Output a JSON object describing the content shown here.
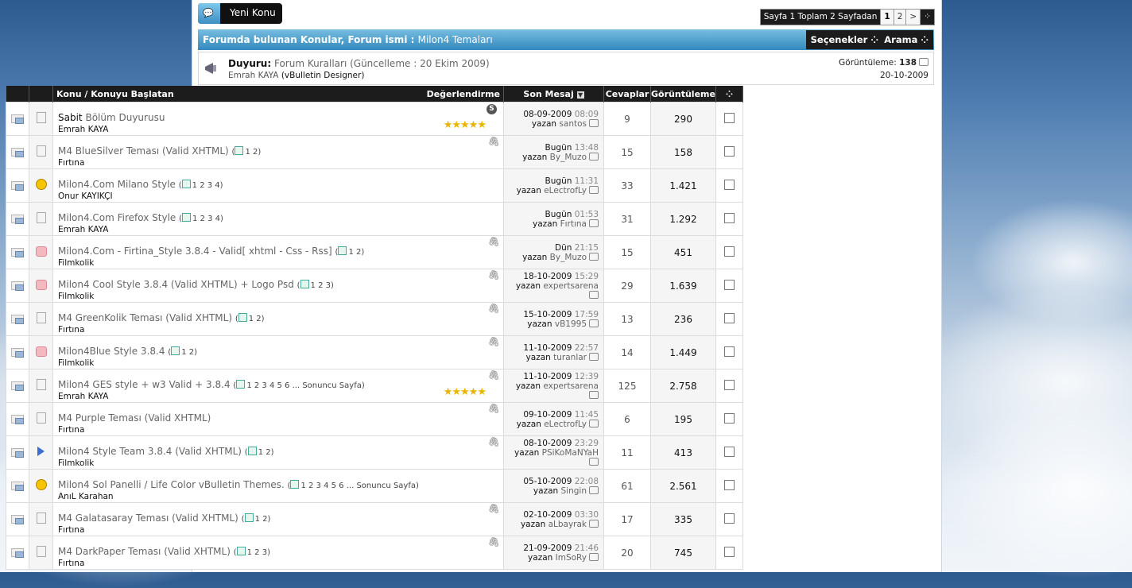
{
  "toolbar": {
    "new_topic": "Yeni Konu"
  },
  "pager": {
    "label": "Sayfa 1 Toplam 2 Sayfadan",
    "current": "1",
    "next_page": "2",
    "next": ">"
  },
  "forum": {
    "title_prefix": "Forumda bulunan Konular, Forum ismi",
    "title_name": "Milon4 Temaları",
    "options": "Seçenekler",
    "search": "Arama"
  },
  "announcement": {
    "label": "Duyuru:",
    "title": "Forum Kuralları (Güncelleme : 20 Ekim 2009)",
    "author": "Emrah KAYA",
    "author_title": "(vBulletin Designer)",
    "views_label": "Görüntüleme:",
    "views": "138",
    "date": "20-10-2009"
  },
  "columns": {
    "topic": "Konu / Konuyu Başlatan",
    "rating": "Değerlendirme",
    "last_post": "Son Mesaj",
    "replies": "Cevaplar",
    "views": "Görüntüleme"
  },
  "last_separator": "Sonuncu Sayfa",
  "threads": [
    {
      "prefix": "Sabit",
      "title": "Bölüm Duyurusu",
      "author": "Emrah KAYA",
      "pages": "",
      "date": "08-09-2009",
      "time": "08:09",
      "by": "yazan",
      "user": "santos",
      "replies": "9",
      "views": "290",
      "icon": "doc",
      "stars": "★★★★★",
      "sticky": "S",
      "attach": false
    },
    {
      "prefix": "",
      "title": "M4 BlueSilver Teması (Valid XHTML)",
      "author": "Fırtına",
      "pages": "1 2",
      "date": "Bugün",
      "time": "13:48",
      "by": "yazan",
      "user": "By_Muzo",
      "replies": "15",
      "views": "158",
      "icon": "doc",
      "stars": "",
      "sticky": "",
      "attach": true
    },
    {
      "prefix": "",
      "title": "Milon4.Com Milano Style",
      "author": "Onur KAYIKÇI",
      "pages": "1 2 3 4",
      "date": "Bugün",
      "time": "11:31",
      "by": "yazan",
      "user": "eLectrofLy",
      "replies": "33",
      "views": "1.421",
      "icon": "smile",
      "stars": "",
      "sticky": "",
      "attach": false
    },
    {
      "prefix": "",
      "title": "Milon4.Com Firefox Style",
      "author": "Emrah KAYA",
      "pages": "1 2 3 4",
      "date": "Bugün",
      "time": "01:53",
      "by": "yazan",
      "user": "Fırtına",
      "replies": "31",
      "views": "1.292",
      "icon": "doc",
      "stars": "",
      "sticky": "",
      "attach": false
    },
    {
      "prefix": "",
      "title": "Milon4.Com - Firtina_Style 3.8.4 - Valid[ xhtml - Css - Rss]",
      "author": "Filmkolik",
      "pages": "1 2",
      "date": "Dün",
      "time": "21:15",
      "by": "yazan",
      "user": "By_Muzo",
      "replies": "15",
      "views": "451",
      "icon": "thumb",
      "stars": "",
      "sticky": "",
      "attach": true
    },
    {
      "prefix": "",
      "title": "Milon4 Cool Style 3.8.4 (Valid XHTML) + Logo Psd",
      "author": "Filmkolik",
      "pages": "1 2 3",
      "date": "18-10-2009",
      "time": "15:29",
      "by": "yazan",
      "user": "expertsarena",
      "replies": "29",
      "views": "1.639",
      "icon": "thumb",
      "stars": "",
      "sticky": "",
      "attach": true
    },
    {
      "prefix": "",
      "title": "M4 GreenKolik Teması (Valid XHTML)",
      "author": "Fırtına",
      "pages": "1 2",
      "date": "15-10-2009",
      "time": "17:59",
      "by": "yazan",
      "user": "vB1995",
      "replies": "13",
      "views": "236",
      "icon": "doc",
      "stars": "",
      "sticky": "",
      "attach": true
    },
    {
      "prefix": "",
      "title": "Milon4Blue Style 3.8.4",
      "author": "Filmkolik",
      "pages": "1 2",
      "date": "11-10-2009",
      "time": "22:57",
      "by": "yazan",
      "user": "turanlar",
      "replies": "14",
      "views": "1.449",
      "icon": "thumb",
      "stars": "",
      "sticky": "",
      "attach": true
    },
    {
      "prefix": "",
      "title": "Milon4 GES style + w3 Valid + 3.8.4",
      "author": "Emrah KAYA",
      "pages": "1 2 3 4 5 6 ...",
      "date": "11-10-2009",
      "time": "12:39",
      "by": "yazan",
      "user": "expertsarena",
      "replies": "125",
      "views": "2.758",
      "icon": "doc",
      "stars": "★★★★★",
      "sticky": "",
      "attach": true,
      "last": true
    },
    {
      "prefix": "",
      "title": "M4 Purple Teması (Valid XHTML)",
      "author": "Fırtına",
      "pages": "",
      "date": "09-10-2009",
      "time": "11:45",
      "by": "yazan",
      "user": "eLectrofLy",
      "replies": "6",
      "views": "195",
      "icon": "doc",
      "stars": "",
      "sticky": "",
      "attach": true
    },
    {
      "prefix": "",
      "title": "Milon4 Style Team 3.8.4 (Valid XHTML)",
      "author": "Filmkolik",
      "pages": "1 2",
      "date": "08-10-2009",
      "time": "23:29",
      "by": "yazan",
      "user": "PSiKoMaNYaH",
      "replies": "11",
      "views": "413",
      "icon": "arrow",
      "stars": "",
      "sticky": "",
      "attach": true
    },
    {
      "prefix": "",
      "title": "Milon4 Sol Panelli / Life Color vBulletin Themes.",
      "author": "AnıL Karahan",
      "pages": "1 2 3 4 5 6 ...",
      "date": "05-10-2009",
      "time": "22:08",
      "by": "yazan",
      "user": "Singin",
      "replies": "61",
      "views": "2.561",
      "icon": "smile",
      "stars": "",
      "sticky": "",
      "attach": false,
      "last": true
    },
    {
      "prefix": "",
      "title": "M4 Galatasaray Teması (Valid XHTML)",
      "author": "Fırtına",
      "pages": "1 2",
      "date": "02-10-2009",
      "time": "03:30",
      "by": "yazan",
      "user": "aLbayrak",
      "replies": "17",
      "views": "335",
      "icon": "doc",
      "stars": "",
      "sticky": "",
      "attach": true
    },
    {
      "prefix": "",
      "title": "M4 DarkPaper Teması (Valid XHTML)",
      "author": "Fırtına",
      "pages": "1 2 3",
      "date": "21-09-2009",
      "time": "21:46",
      "by": "yazan",
      "user": "ImSoRy",
      "replies": "20",
      "views": "745",
      "icon": "doc",
      "stars": "",
      "sticky": "",
      "attach": true
    }
  ]
}
